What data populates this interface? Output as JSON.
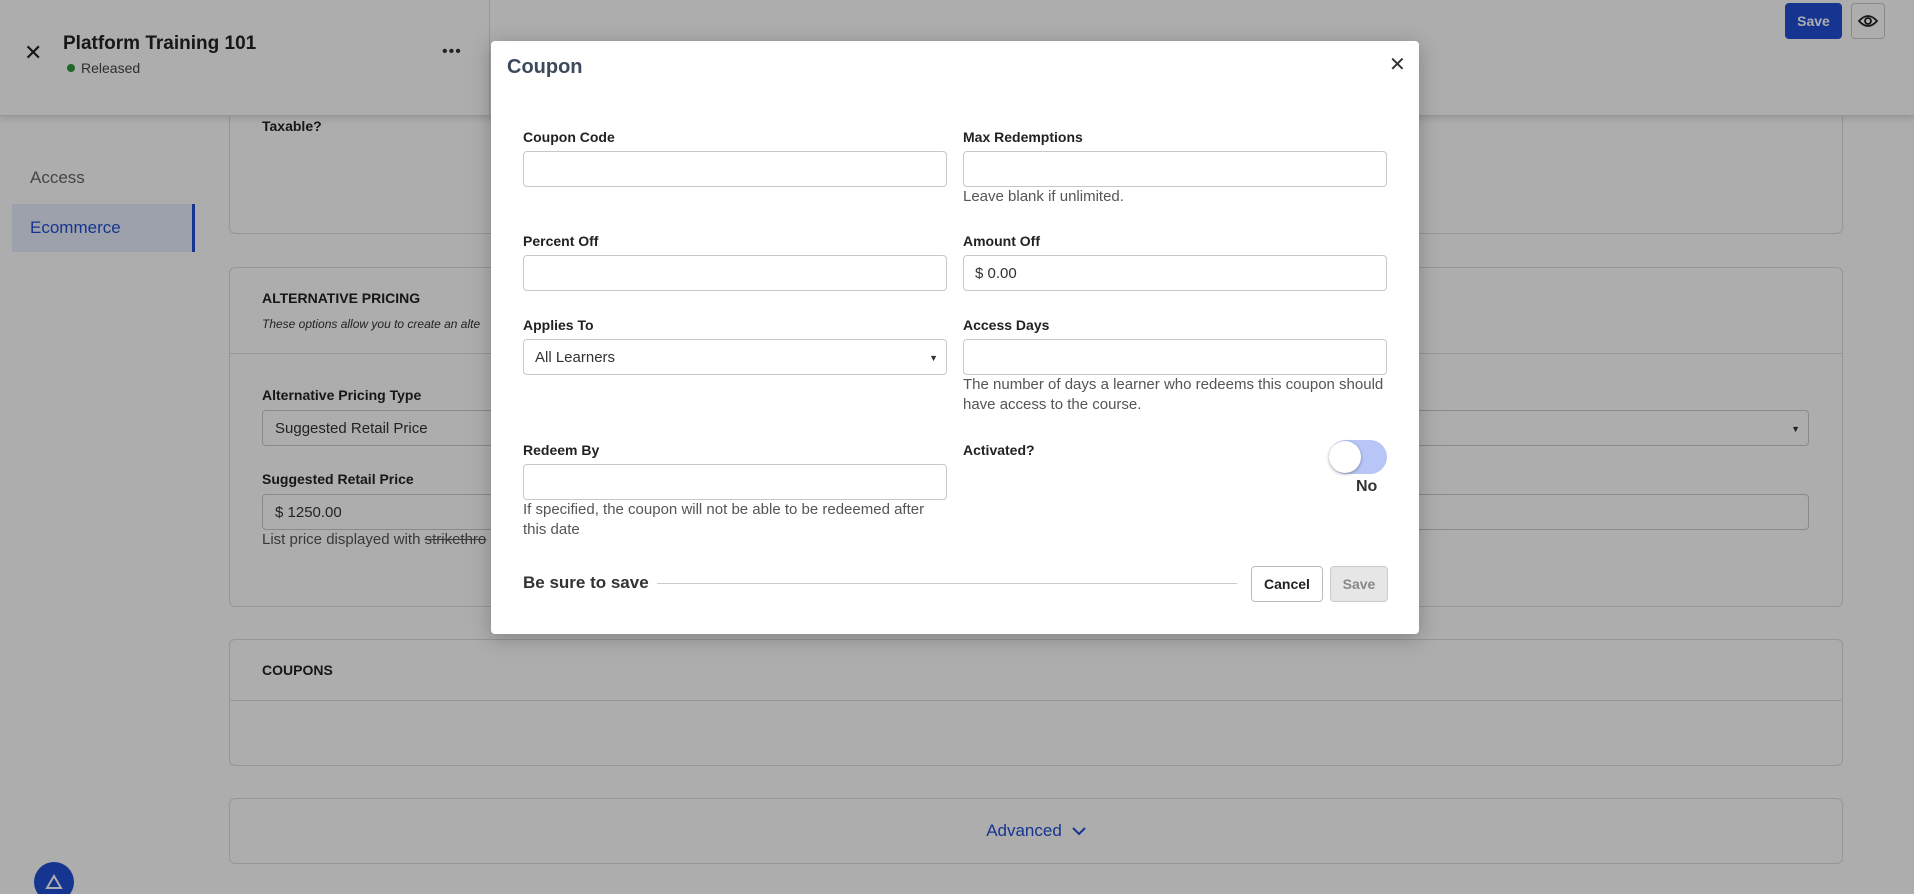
{
  "header": {
    "course_title": "Platform Training 101",
    "status": "Released",
    "save_label": "Save"
  },
  "sidebar": {
    "items": [
      {
        "label": "Access"
      },
      {
        "label": "Ecommerce"
      }
    ]
  },
  "background": {
    "taxable_label": "Taxable?",
    "alt_pricing": {
      "heading": "ALTERNATIVE PRICING",
      "description": "These options allow you to create an alte",
      "type_label": "Alternative Pricing Type",
      "type_value": "Suggested Retail Price",
      "srp_label": "Suggested Retail Price",
      "srp_value": "$ 1250.00",
      "srp_hint_prefix": "List price displayed with ",
      "srp_hint_strike": "strikethro"
    },
    "coupons_heading": "COUPONS",
    "advanced_label": "Advanced"
  },
  "modal": {
    "title": "Coupon",
    "coupon_code": {
      "label": "Coupon Code",
      "value": ""
    },
    "max_redemptions": {
      "label": "Max Redemptions",
      "value": "",
      "hint": "Leave blank if unlimited."
    },
    "percent_off": {
      "label": "Percent Off",
      "value": ""
    },
    "amount_off": {
      "label": "Amount Off",
      "value": "$ 0.00"
    },
    "applies_to": {
      "label": "Applies To",
      "value": "All Learners"
    },
    "access_days": {
      "label": "Access Days",
      "value": "",
      "hint": "The number of days a learner who redeems this coupon should have access to the course."
    },
    "redeem_by": {
      "label": "Redeem By",
      "value": "",
      "hint": "If specified, the coupon will not be able to be redeemed after this date"
    },
    "activated": {
      "label": "Activated?",
      "state_text": "No",
      "on": false
    },
    "footer_text": "Be sure to save",
    "cancel_label": "Cancel",
    "save_label": "Save"
  },
  "colors": {
    "accent": "#1f4fd6",
    "status_green": "#2e9b3a",
    "toggle_track": "#b7c6f7"
  },
  "icons": [
    "close-icon",
    "more-icon",
    "eye-icon",
    "chevron-down-icon",
    "caret-down-icon",
    "app-logo-icon"
  ]
}
